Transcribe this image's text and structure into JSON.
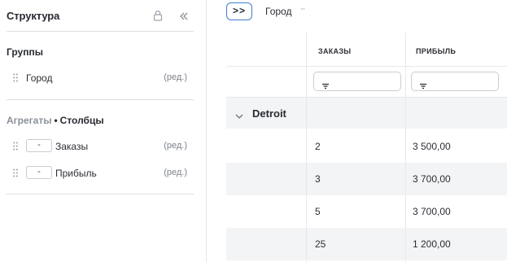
{
  "sidebar": {
    "title": "Структура",
    "groups_title": "Группы",
    "group_fields": [
      {
        "label": "Город",
        "edit": "(ред.)"
      }
    ],
    "aggregates_title": "Агрегаты",
    "columns_title": "Столбцы",
    "dot": "•",
    "agg_fields": [
      {
        "agg": "-",
        "label": "Заказы",
        "edit": "(ред.)"
      },
      {
        "agg": "-",
        "label": "Прибыль",
        "edit": "(ред.)"
      }
    ]
  },
  "toolbar": {
    "expand_label": ">>",
    "group_chip": "Город",
    "chip_more": "··"
  },
  "table": {
    "columns": [
      "ЗАКАЗЫ",
      "ПРИБЫЛЬ"
    ],
    "group": "Detroit",
    "rows": [
      [
        "2",
        "3 500,00"
      ],
      [
        "3",
        "3 700,00"
      ],
      [
        "5",
        "3 700,00"
      ],
      [
        "25",
        "1 200,00"
      ]
    ]
  }
}
